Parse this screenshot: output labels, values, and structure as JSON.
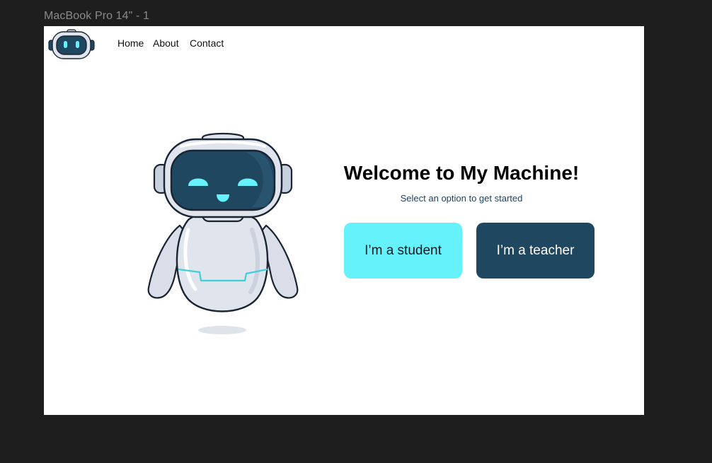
{
  "frame": {
    "label": "MacBook Pro 14\" - 1"
  },
  "nav": {
    "home": "Home",
    "about": "About",
    "contact": "Contact"
  },
  "hero": {
    "title": "Welcome to My Machine!",
    "subtitle": "Select an option to get started"
  },
  "buttons": {
    "student": "I’m a student",
    "teacher": "I’m a teacher"
  },
  "colors": {
    "student_button": "#66f2fa",
    "teacher_button": "#1f4760",
    "robot_visor": "#1f4760",
    "robot_eyes": "#66f2fa",
    "background": "#1e1e1e"
  },
  "icons": {
    "logo": "robot-head-icon",
    "illustration": "robot-illustration"
  }
}
